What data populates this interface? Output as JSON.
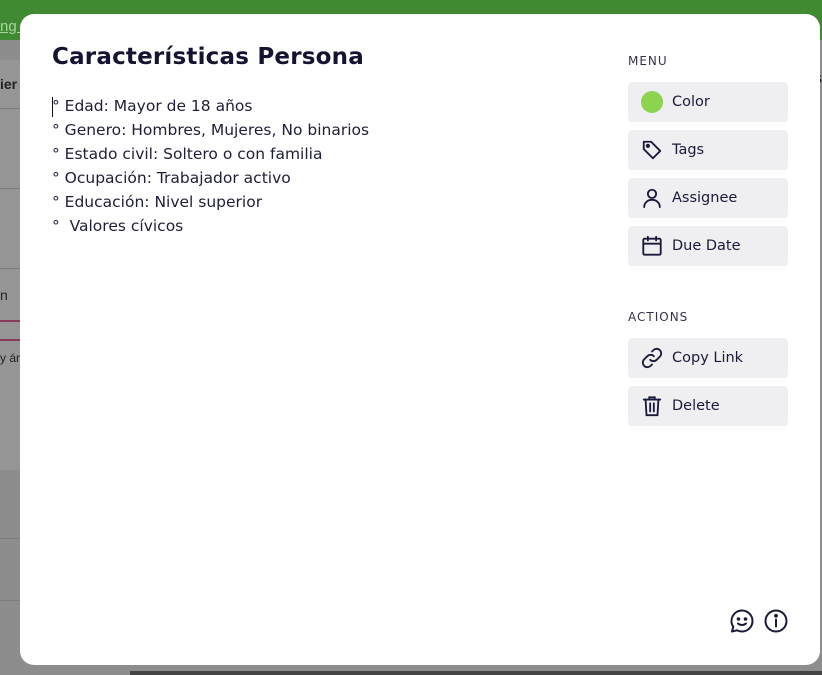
{
  "background": {
    "topbar_fragment": "ng t",
    "side_fragments": [
      "ier",
      "n",
      "y ár"
    ]
  },
  "card": {
    "title": "Características Persona",
    "description_lines": [
      "° Edad: Mayor de 18 años",
      "° Genero: Hombres, Mujeres, No binarios",
      "° Estado civil: Soltero o con familia",
      "° Ocupación: Trabajador activo",
      "° Educación: Nivel superior",
      "°  Valores cívicos"
    ]
  },
  "menu": {
    "label": "MENU",
    "items": [
      {
        "label": "Color",
        "icon": "color-dot-icon",
        "color": "#8cd34f"
      },
      {
        "label": "Tags",
        "icon": "tag-icon"
      },
      {
        "label": "Assignee",
        "icon": "user-icon"
      },
      {
        "label": "Due Date",
        "icon": "calendar-icon"
      }
    ]
  },
  "actions": {
    "label": "ACTIONS",
    "items": [
      {
        "label": "Copy Link",
        "icon": "link-icon"
      },
      {
        "label": "Delete",
        "icon": "trash-icon"
      }
    ]
  },
  "footer_icons": [
    "comment-smile-icon",
    "info-icon"
  ],
  "colors": {
    "accent_green": "#8cd34f",
    "topbar_green": "#3f8a33",
    "button_bg": "#efeff1",
    "text_dark": "#141432"
  }
}
